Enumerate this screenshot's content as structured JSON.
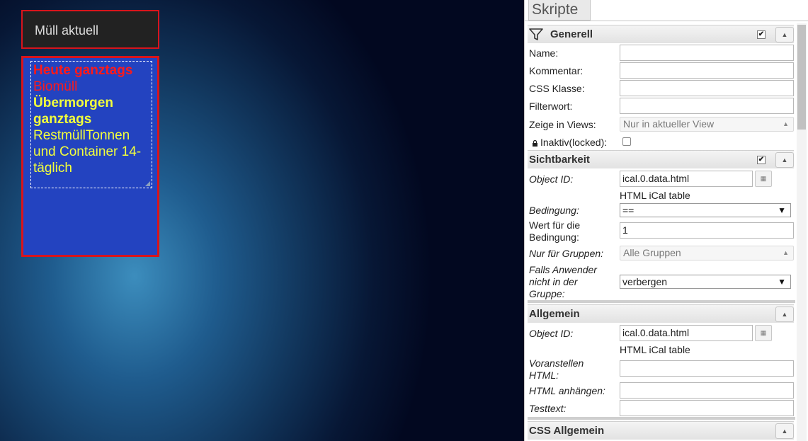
{
  "canvas": {
    "title_widget": {
      "text": "Müll aktuell"
    },
    "ical_widget": {
      "today_label": "Heute ganztags",
      "today_event": "Biomüll",
      "later_label": "Übermorgen ganztags",
      "later_event": "RestmüllTonnen und Container 14-täglich"
    }
  },
  "panel": {
    "tab_label": "Skripte",
    "sections": {
      "generell": {
        "title": "Generell",
        "checked": true,
        "fields": {
          "name_label": "Name:",
          "name_value": "",
          "kommentar_label": "Kommentar:",
          "kommentar_value": "",
          "css_klasse_label": "CSS Klasse:",
          "css_klasse_value": "",
          "filterwort_label": "Filterwort:",
          "filterwort_value": "",
          "zeige_label": "Zeige in Views:",
          "zeige_value": "Nur in aktueller View",
          "inaktiv_label": "Inaktiv(locked):",
          "inaktiv_checked": false
        }
      },
      "sichtbarkeit": {
        "title": "Sichtbarkeit",
        "checked": true,
        "fields": {
          "object_id_label": "Object ID:",
          "object_id_value": "ical.0.data.html",
          "object_id_hint": "HTML iCal table",
          "bedingung_label": "Bedingung:",
          "bedingung_value": "==",
          "wert_label": "Wert für die Bedingung:",
          "wert_value": "1",
          "gruppen_label": "Nur für Gruppen:",
          "gruppen_value": "Alle Gruppen",
          "falls_label": "Falls Anwender nicht in der Gruppe:",
          "falls_value": "verbergen"
        }
      },
      "allgemein": {
        "title": "Allgemein",
        "fields": {
          "object_id_label": "Object ID:",
          "object_id_value": "ical.0.data.html",
          "object_id_hint": "HTML iCal table",
          "voranstellen_label": "Voranstellen HTML:",
          "voranstellen_value": "",
          "anhaengen_label": "HTML anhängen:",
          "anhaengen_value": "",
          "testtext_label": "Testtext:",
          "testtext_value": ""
        }
      },
      "css_allgemein": {
        "title": "CSS Allgemein"
      }
    }
  },
  "icons": {
    "filter": "filter-icon",
    "collapse": "chevron-up-icon",
    "picker": "list-picker-icon",
    "lock": "lock-icon"
  }
}
